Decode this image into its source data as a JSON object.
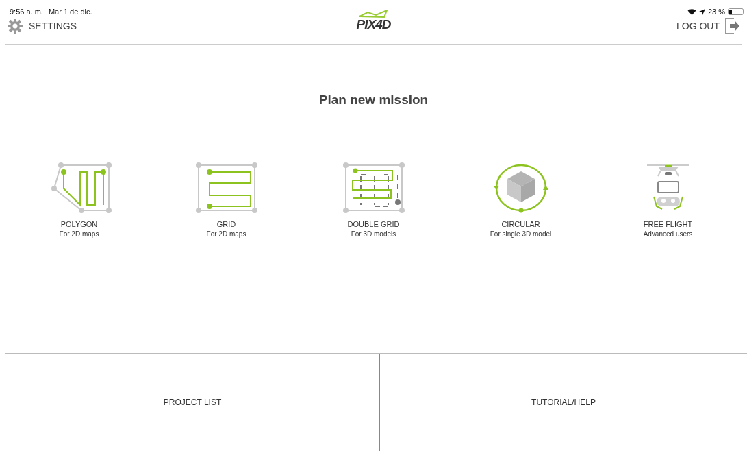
{
  "status_bar": {
    "time": "9:56 a. m.",
    "date": "Mar 1 de dic.",
    "battery": "23 %"
  },
  "header": {
    "settings": "SETTINGS",
    "logo": "PIX4D",
    "logout": "LOG OUT"
  },
  "title": "Plan new mission",
  "missions": [
    {
      "kind": "polygon",
      "label": "POLYGON",
      "subtitle": "For 2D maps"
    },
    {
      "kind": "grid",
      "label": "GRID",
      "subtitle": "For 2D maps"
    },
    {
      "kind": "double_grid",
      "label": "DOUBLE GRID",
      "subtitle": "For 3D models"
    },
    {
      "kind": "circular",
      "label": "CIRCULAR",
      "subtitle": "For single 3D model"
    },
    {
      "kind": "free_flight",
      "label": "FREE FLIGHT",
      "subtitle": "Advanced users"
    }
  ],
  "bottom_buttons": [
    "PROJECT LIST",
    "TUTORIAL/HELP"
  ]
}
